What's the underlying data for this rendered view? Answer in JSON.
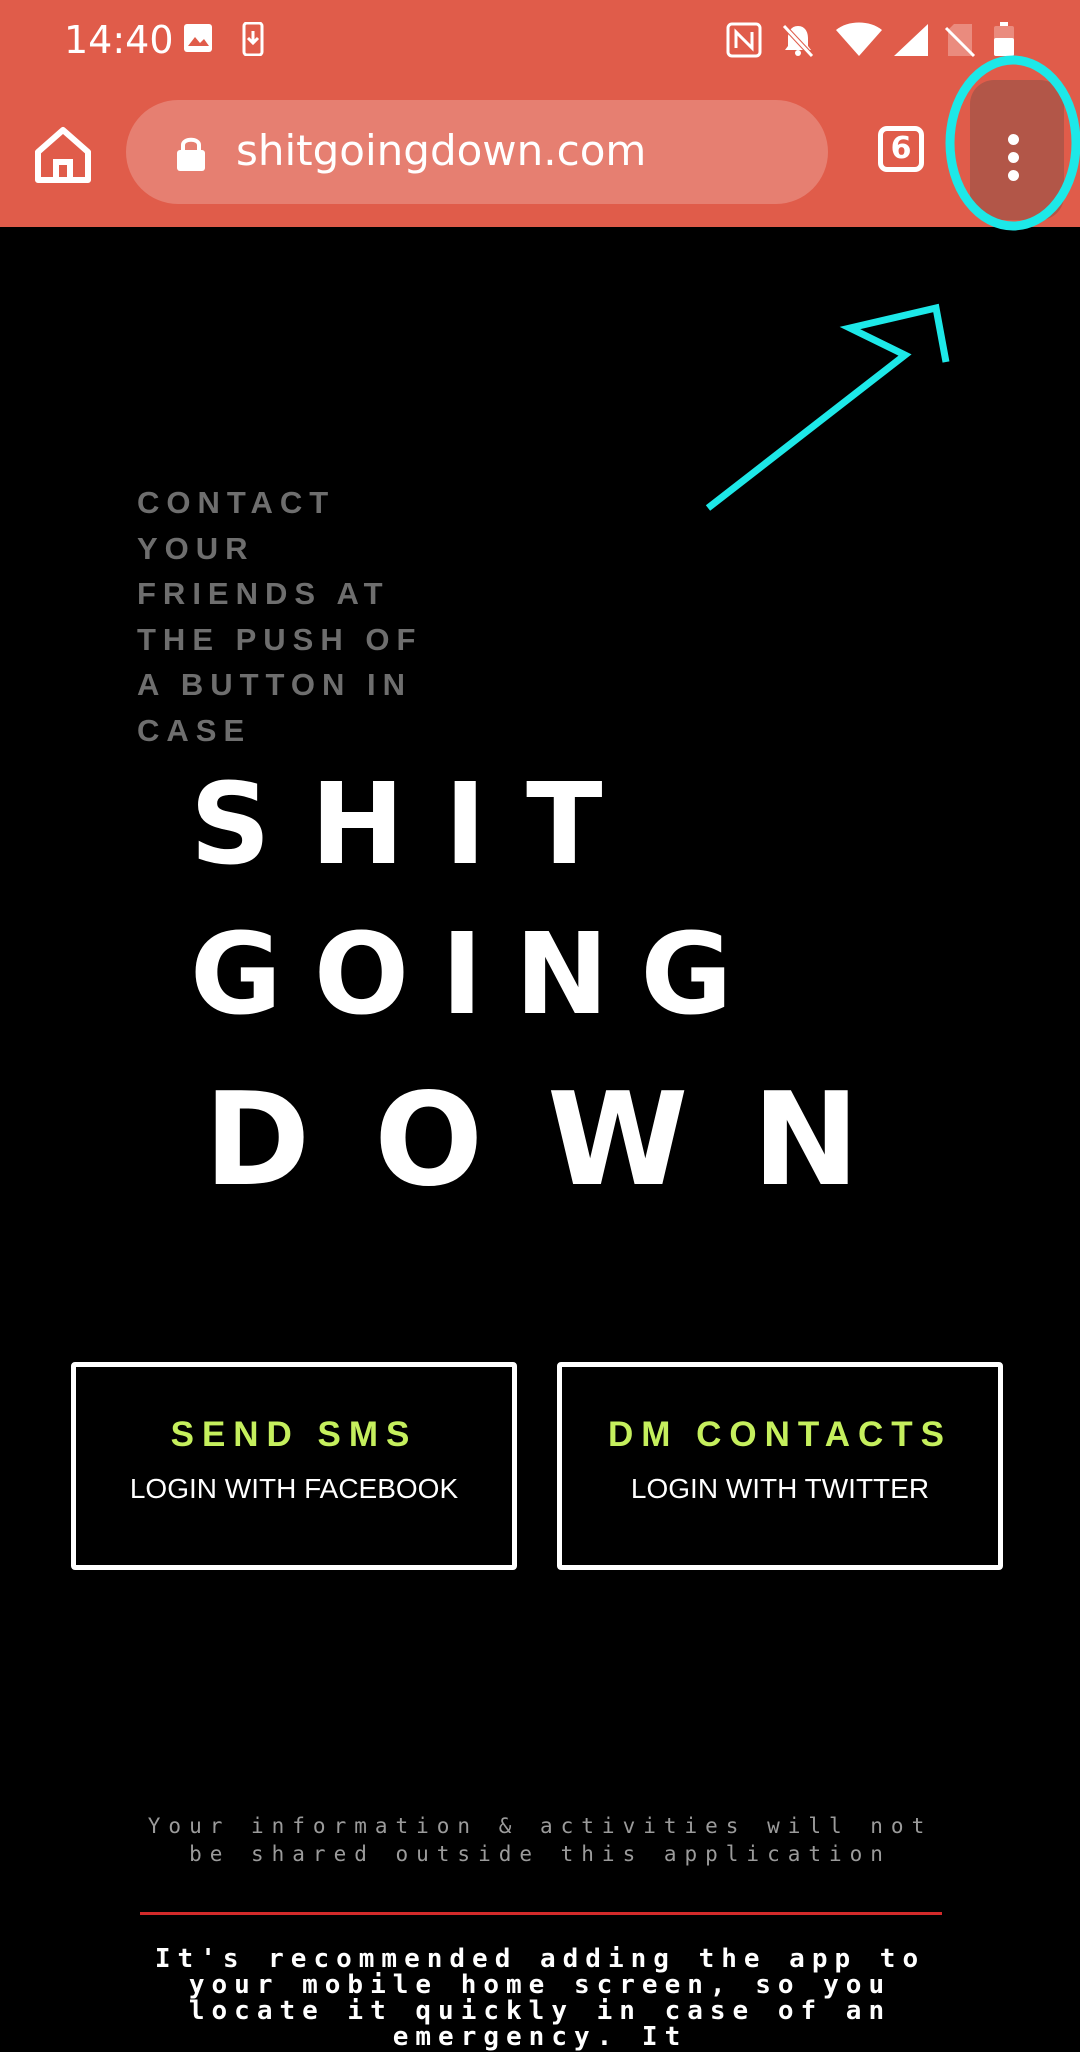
{
  "status_bar": {
    "time": "14:40",
    "icons_left": [
      "image-icon",
      "download-phone-icon"
    ],
    "icons_right": [
      "nfc-icon",
      "mute-bell-icon",
      "wifi-icon",
      "signal-icon",
      "no-sim-icon",
      "battery-icon"
    ]
  },
  "browser": {
    "url": "shitgoingdown.com",
    "tab_count": "6",
    "theme_color": "#e05c4a"
  },
  "annotation": {
    "highlight_color": "#1de8e8",
    "target": "overflow-menu"
  },
  "hero": {
    "tagline": "CONTACT\nYOUR\nFRIENDS AT\nTHE PUSH OF\nA BUTTON IN\nCASE",
    "title_line1": "SHIT",
    "title_line2": "GOING",
    "title_line3": "DOWN"
  },
  "actions": {
    "sms_label": "SEND SMS",
    "sms_sub": "LOGIN WITH FACEBOOK",
    "dm_label": "DM CONTACTS",
    "dm_sub": "LOGIN WITH TWITTER",
    "accent_color": "#c5ef5d"
  },
  "footer": {
    "privacy": "Your information & activities will not be shared outside this application",
    "recommend": "It's recommended adding the app to your mobile home screen, so you locate it quickly in case of an emergency. It"
  }
}
